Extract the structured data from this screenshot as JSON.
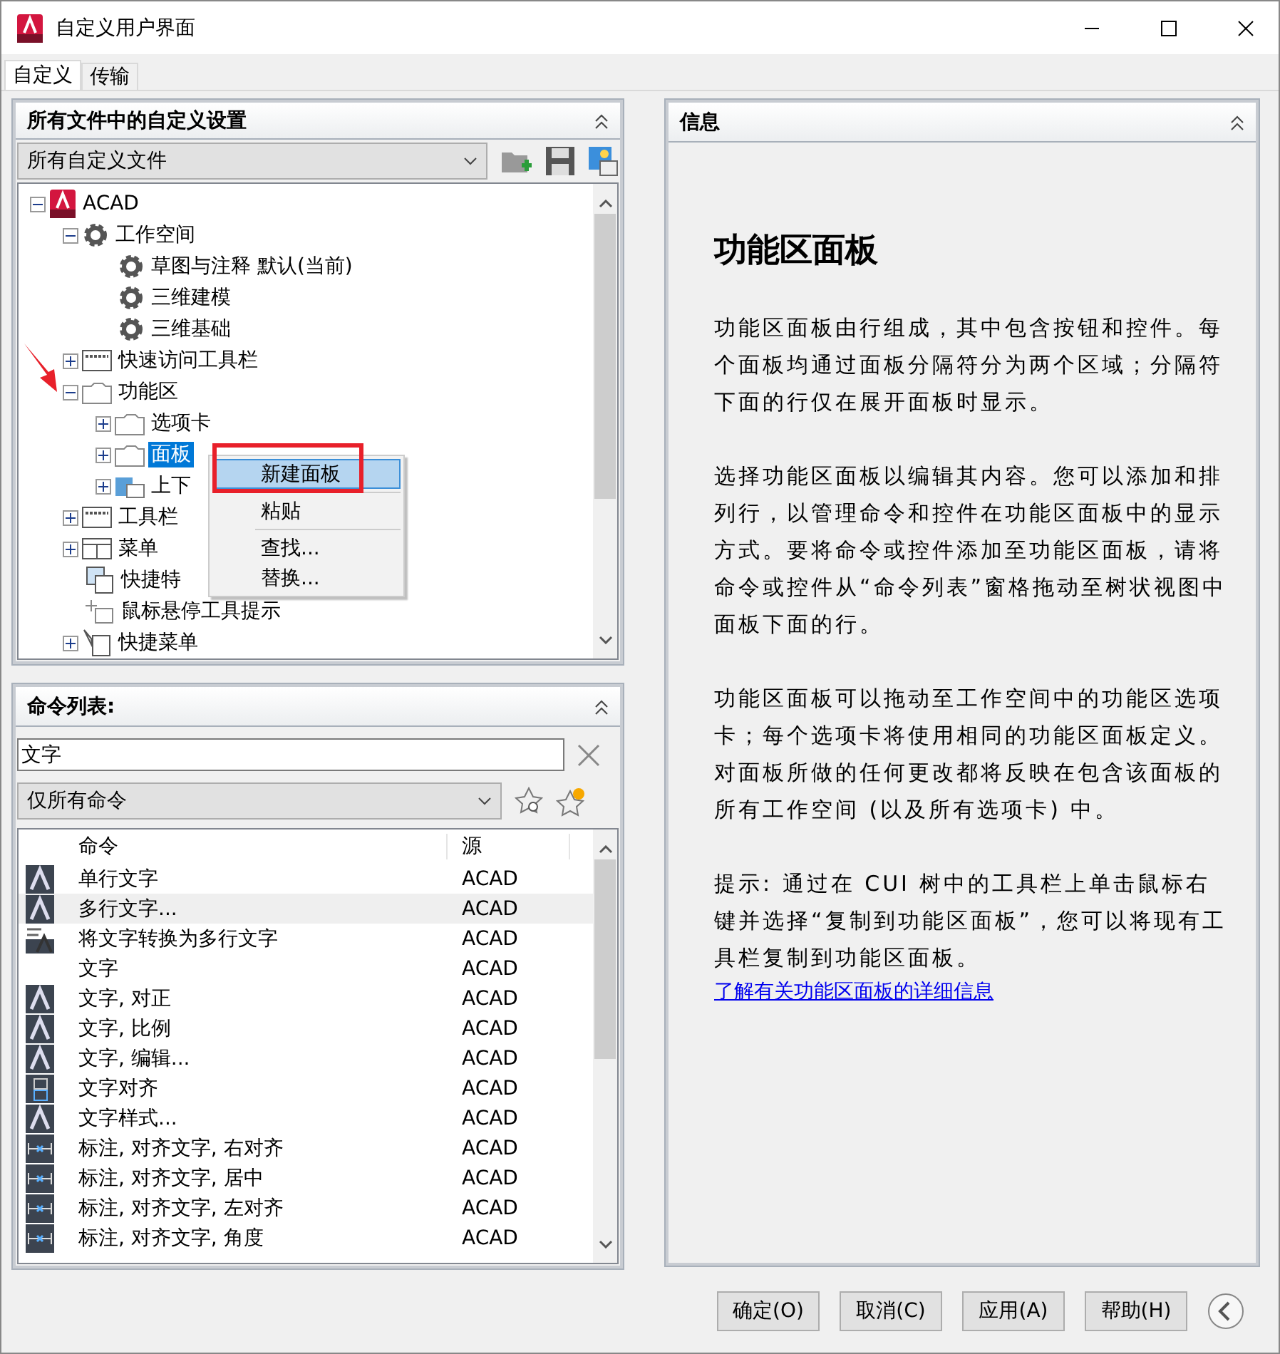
{
  "window": {
    "title": "自定义用户界面"
  },
  "tabs": [
    {
      "label": "自定义",
      "selected": true
    },
    {
      "label": "传输",
      "selected": false
    }
  ],
  "customizations": {
    "title": "所有文件中的自定义设置",
    "file_select": "所有自定义文件",
    "tree": [
      {
        "label": "ACAD",
        "kind": "app",
        "expanded": true,
        "selected": false,
        "children": [
          {
            "label": "工作空间",
            "kind": "gear",
            "expanded": true,
            "selected": false,
            "children": [
              {
                "label": "草图与注释 默认(当前)",
                "kind": "gear",
                "selected": false
              },
              {
                "label": "三维建模",
                "kind": "gear",
                "selected": false
              },
              {
                "label": "三维基础",
                "kind": "gear",
                "selected": false
              }
            ]
          },
          {
            "label": "快速访问工具栏",
            "kind": "toolbar",
            "expanded": false,
            "selected": false
          },
          {
            "label": "功能区",
            "kind": "folder",
            "expanded": true,
            "selected": false,
            "children": [
              {
                "label": "选项卡",
                "kind": "folder",
                "expanded": false,
                "selected": false
              },
              {
                "label": "面板",
                "kind": "folder",
                "expanded": false,
                "selected": true
              },
              {
                "label": "上下",
                "kind": "panel",
                "expanded": false,
                "selected": false
              }
            ]
          },
          {
            "label": "工具栏",
            "kind": "toolbar",
            "expanded": false,
            "selected": false
          },
          {
            "label": "菜单",
            "kind": "menu",
            "expanded": false,
            "selected": false
          },
          {
            "label": "快捷特",
            "kind": "props"
          },
          {
            "label": "鼠标悬停工具提示",
            "kind": "tip"
          },
          {
            "label": "快捷菜单",
            "kind": "cursor",
            "expanded": false,
            "selected": false
          }
        ]
      }
    ],
    "context_menu": [
      {
        "label": "新建面板",
        "selected": true
      },
      {
        "label": "粘贴",
        "selected": false
      },
      {
        "label": "查找...",
        "selected": false
      },
      {
        "label": "替换...",
        "selected": false
      }
    ]
  },
  "command_list": {
    "title": "命令列表:",
    "search": "文字",
    "filter": "仅所有命令",
    "columns": [
      "命令",
      "源"
    ],
    "rows": [
      {
        "kind": "text",
        "name": "单行文字",
        "source": "ACAD",
        "selected": false
      },
      {
        "kind": "text",
        "name": "多行文字...",
        "source": "ACAD",
        "selected": true
      },
      {
        "kind": "convert",
        "name": "将文字转换为多行文字",
        "source": "ACAD",
        "selected": false
      },
      {
        "kind": "none",
        "name": "文字",
        "source": "ACAD",
        "selected": false
      },
      {
        "kind": "text",
        "name": "文字, 对正",
        "source": "ACAD",
        "selected": false
      },
      {
        "kind": "text",
        "name": "文字, 比例",
        "source": "ACAD",
        "selected": false
      },
      {
        "kind": "text",
        "name": "文字, 编辑...",
        "source": "ACAD",
        "selected": false
      },
      {
        "kind": "align",
        "name": "文字对齐",
        "source": "ACAD",
        "selected": false
      },
      {
        "kind": "text",
        "name": "文字样式...",
        "source": "ACAD",
        "selected": false
      },
      {
        "kind": "dim",
        "name": "标注, 对齐文字, 右对齐",
        "source": "ACAD",
        "selected": false
      },
      {
        "kind": "dim",
        "name": "标注, 对齐文字, 居中",
        "source": "ACAD",
        "selected": false
      },
      {
        "kind": "dim",
        "name": "标注, 对齐文字, 左对齐",
        "source": "ACAD",
        "selected": false
      },
      {
        "kind": "dim",
        "name": "标注, 对齐文字, 角度",
        "source": "ACAD",
        "selected": false
      }
    ]
  },
  "info": {
    "title": "信息",
    "heading": "功能区面板",
    "paragraphs": [
      "功能区面板由行组成，其中包含按钮和控件。每个面板均通过面板分隔符分为两个区域；分隔符下面的行仅在展开面板时显示。",
      "选择功能区面板以编辑其内容。您可以添加和排列行，以管理命令和控件在功能区面板中的显示方式。要将命令或控件添加至功能区面板，请将命令或控件从“命令列表”窗格拖动至树状视图中面板下面的行。",
      "功能区面板可以拖动至工作空间中的功能区选项卡；每个选项卡将使用相同的功能区面板定义。对面板所做的任何更改都将反映在包含该面板的所有工作空间 (以及所有选项卡) 中。",
      "提示: 通过在 CUI 树中的工具栏上单击鼠标右键并选择“复制到功能区面板”，您可以将现有工具栏复制到功能区面板。"
    ],
    "link": "了解有关功能区面板的详细信息"
  },
  "buttons": [
    "确定(O)",
    "取消(C)",
    "应用(A)",
    "帮助(H)"
  ]
}
